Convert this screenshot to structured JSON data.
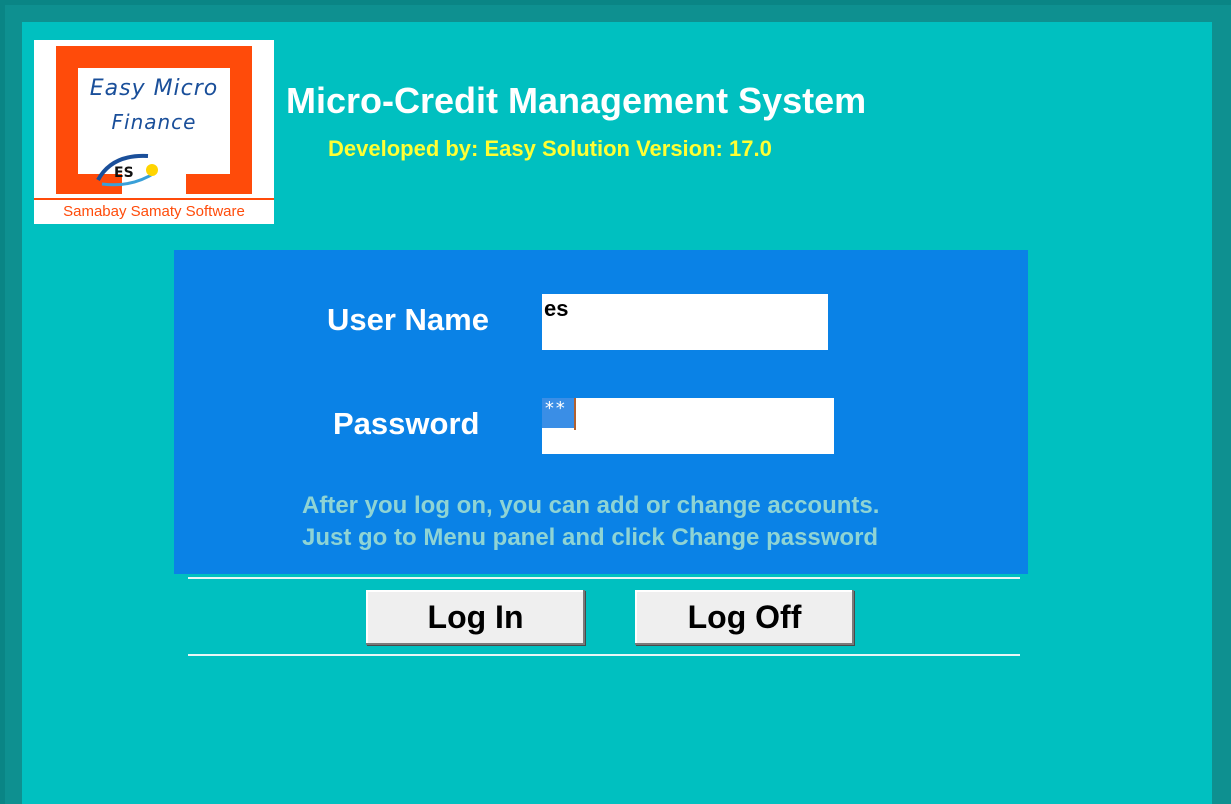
{
  "logo": {
    "title": "Easy Micro",
    "subtitle": "Finance",
    "mark": "ES",
    "footer": "Samabay Samaty Software",
    "brand_color": "#ff4b0a",
    "text_color": "#1a4f9a"
  },
  "header": {
    "title": "Micro-Credit Management System",
    "developer": "Developed by: Easy Solution Version: 17.0"
  },
  "form": {
    "username_label": "User Name",
    "username_value": "es",
    "password_label": "Password",
    "password_value": "**",
    "hint_line1": "After you log on, you can add or change accounts.",
    "hint_line2": "Just go to Menu panel and click Change password"
  },
  "buttons": {
    "login": "Log In",
    "logoff": "Log Off"
  },
  "colors": {
    "background": "#00c0c0",
    "border": "#0a8585",
    "panel": "#0a82e6",
    "title": "#ffffff",
    "subtitle": "#ffff33",
    "hint": "#8fd4d4"
  }
}
